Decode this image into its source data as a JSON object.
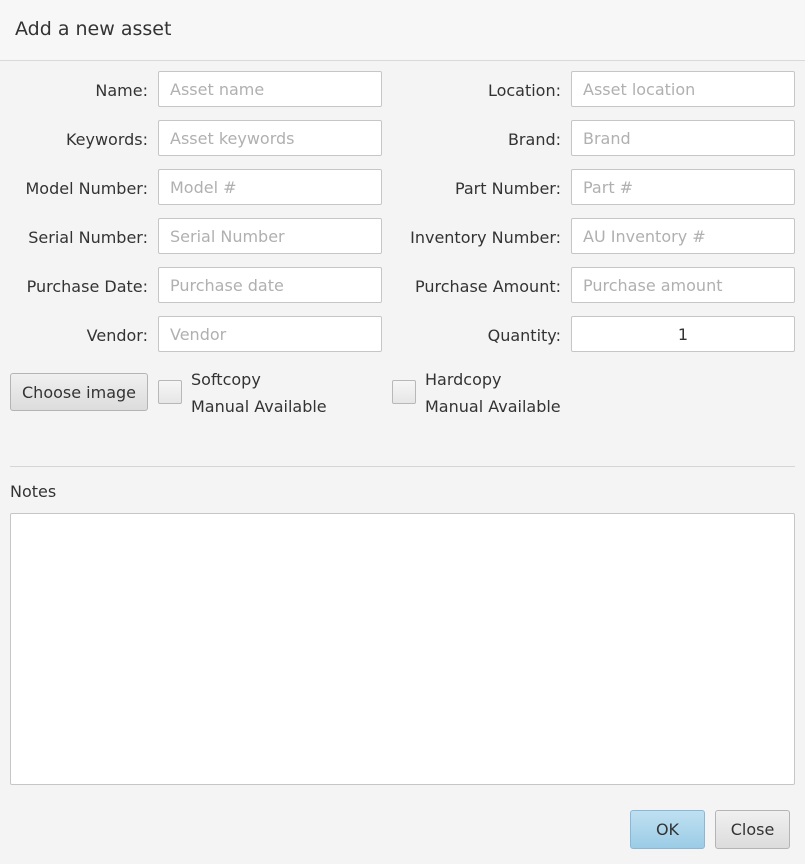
{
  "dialog": {
    "title": "Add a new asset"
  },
  "form": {
    "name": {
      "label": "Name:",
      "placeholder": "Asset name",
      "value": ""
    },
    "location": {
      "label": "Location:",
      "placeholder": "Asset location",
      "value": ""
    },
    "keywords": {
      "label": "Keywords:",
      "placeholder": "Asset keywords",
      "value": ""
    },
    "brand": {
      "label": "Brand:",
      "placeholder": "Brand",
      "value": ""
    },
    "model_number": {
      "label": "Model Number:",
      "placeholder": "Model #",
      "value": ""
    },
    "part_number": {
      "label": "Part Number:",
      "placeholder": "Part #",
      "value": ""
    },
    "serial_number": {
      "label": "Serial Number:",
      "placeholder": "Serial Number",
      "value": ""
    },
    "inventory_number": {
      "label": "Inventory Number:",
      "placeholder": "AU Inventory #",
      "value": ""
    },
    "purchase_date": {
      "label": "Purchase Date:",
      "placeholder": "Purchase date",
      "value": ""
    },
    "purchase_amount": {
      "label": "Purchase Amount:",
      "placeholder": "Purchase amount",
      "value": ""
    },
    "vendor": {
      "label": "Vendor:",
      "placeholder": "Vendor",
      "value": ""
    },
    "quantity": {
      "label": "Quantity:",
      "value": "1"
    }
  },
  "options": {
    "choose_image_label": "Choose image",
    "softcopy": {
      "line1": "Softcopy",
      "line2": "Manual Available",
      "checked": false
    },
    "hardcopy": {
      "line1": "Hardcopy",
      "line2": "Manual Available",
      "checked": false
    }
  },
  "notes": {
    "label": "Notes",
    "value": ""
  },
  "footer": {
    "ok_label": "OK",
    "close_label": "Close"
  }
}
